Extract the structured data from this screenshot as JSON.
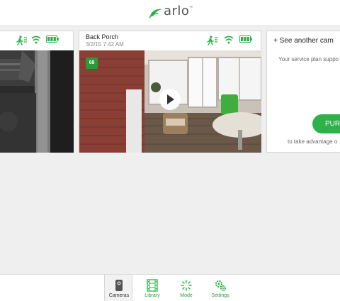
{
  "app": {
    "logo_text": "arlo"
  },
  "colors": {
    "brand_green": "#2eb14a",
    "badge_green": "#2a9a3a"
  },
  "cameras": [
    {
      "name": "",
      "time": "",
      "icons": [
        "motion-sensor-icon",
        "wifi-signal-icon",
        "battery-icon"
      ]
    },
    {
      "name": "Back Porch",
      "time": "3/2/15 7:42 AM",
      "temperature": "68",
      "icons": [
        "motion-sensor-icon",
        "wifi-signal-icon",
        "battery-icon"
      ]
    }
  ],
  "promo": {
    "title": "+ See another cam",
    "service_text": "Your service plan suppo",
    "button_label": "PURC",
    "advantage_text": "to take advantage o"
  },
  "nav": {
    "items": [
      {
        "label": "Cameras",
        "icon": "camera-icon",
        "active": true
      },
      {
        "label": "Library",
        "icon": "film-strip-icon",
        "active": false
      },
      {
        "label": "Mode",
        "icon": "mode-spinner-icon",
        "active": false
      },
      {
        "label": "Settings",
        "icon": "gears-icon",
        "active": false
      }
    ]
  }
}
